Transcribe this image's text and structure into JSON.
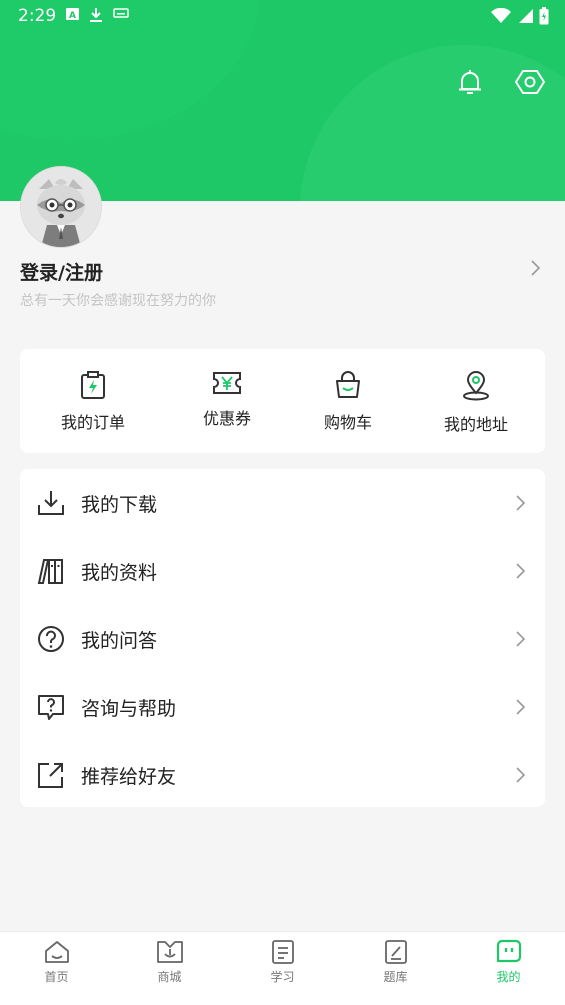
{
  "status_bar": {
    "time": "2:29"
  },
  "profile": {
    "title": "登录/注册",
    "subtitle": "总有一天你会感谢现在努力的你"
  },
  "quick_actions": [
    {
      "label": "我的订单",
      "icon": "clipboard-bolt-icon"
    },
    {
      "label": "优惠券",
      "icon": "coupon-yen-icon"
    },
    {
      "label": "购物车",
      "icon": "shopping-bag-icon"
    },
    {
      "label": "我的地址",
      "icon": "location-pin-icon"
    }
  ],
  "menu": [
    {
      "label": "我的下载",
      "icon": "download-icon"
    },
    {
      "label": "我的资料",
      "icon": "books-icon"
    },
    {
      "label": "我的问答",
      "icon": "question-circle-icon"
    },
    {
      "label": "咨询与帮助",
      "icon": "help-chat-icon"
    },
    {
      "label": "推荐给好友",
      "icon": "share-icon"
    }
  ],
  "tabbar": [
    {
      "label": "首页",
      "icon": "home-icon",
      "active": false
    },
    {
      "label": "商城",
      "icon": "mall-icon",
      "active": false
    },
    {
      "label": "学习",
      "icon": "study-icon",
      "active": false
    },
    {
      "label": "题库",
      "icon": "question-bank-icon",
      "active": false
    },
    {
      "label": "我的",
      "icon": "mine-icon",
      "active": true
    }
  ],
  "colors": {
    "brand": "#1ec867",
    "text": "#222222",
    "muted": "#c4c4c4"
  }
}
